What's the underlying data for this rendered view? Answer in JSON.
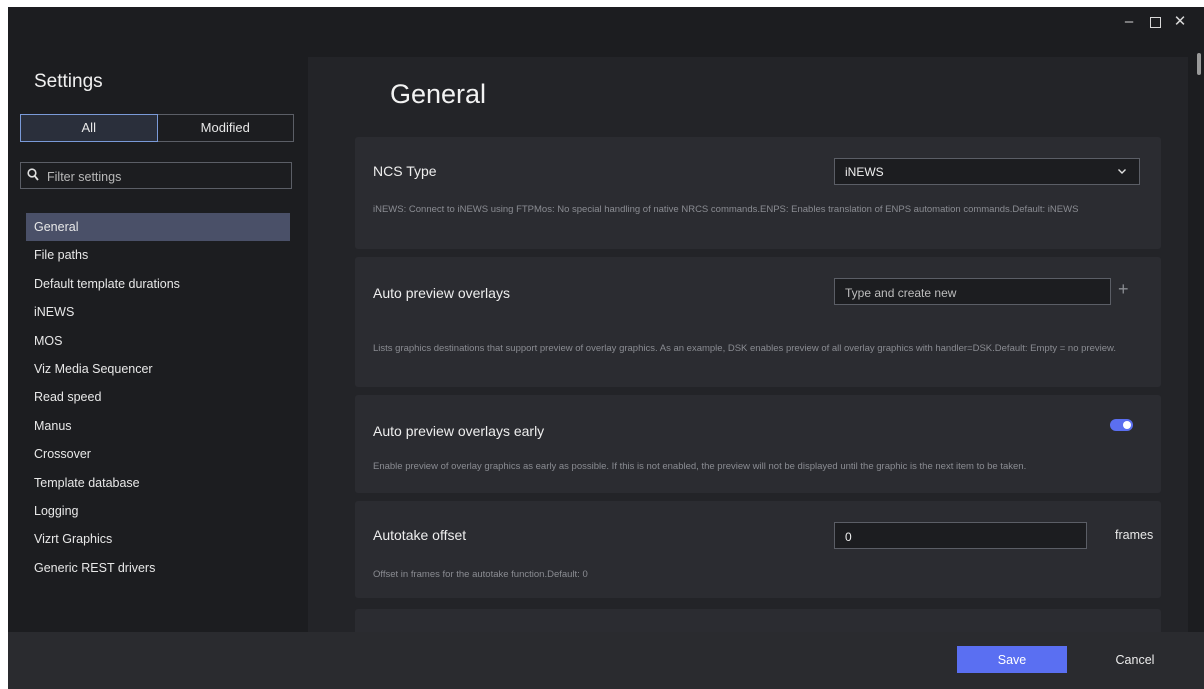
{
  "window": {
    "controls": {
      "minimize": "–",
      "close": "✕"
    }
  },
  "sidebar": {
    "title": "Settings",
    "segments": {
      "all": "All",
      "modified": "Modified"
    },
    "filter_placeholder": "Filter settings",
    "items": [
      {
        "label": "General",
        "active": true
      },
      {
        "label": "File paths"
      },
      {
        "label": "Default template durations"
      },
      {
        "label": "iNEWS"
      },
      {
        "label": "MOS"
      },
      {
        "label": "Viz Media Sequencer"
      },
      {
        "label": "Read speed"
      },
      {
        "label": "Manus"
      },
      {
        "label": "Crossover"
      },
      {
        "label": "Template database"
      },
      {
        "label": "Logging"
      },
      {
        "label": "Vizrt Graphics"
      },
      {
        "label": "Generic REST drivers"
      }
    ]
  },
  "main": {
    "title": "General",
    "settings": [
      {
        "label": "NCS Type",
        "selected": "iNEWS",
        "description": "iNEWS: Connect to iNEWS using FTPMos: No special handling of native NRCS commands.ENPS: Enables translation of ENPS automation commands.Default: iNEWS"
      },
      {
        "label": "Auto preview overlays",
        "placeholder": "Type and create new",
        "add_icon": "+",
        "description": "Lists graphics destinations that support preview of overlay graphics. As an example, DSK enables preview of all overlay graphics with handler=DSK.Default: Empty = no preview."
      },
      {
        "label": "Auto preview overlays early",
        "enabled": true,
        "description": "Enable preview of overlay graphics as early as possible. If this is not enabled, the preview will not be displayed until the graphic is the next item to be taken."
      },
      {
        "label": "Autotake offset",
        "value": "0",
        "unit": "frames",
        "description": "Offset in frames for the autotake function.Default: 0"
      }
    ]
  },
  "footer": {
    "save": "Save",
    "cancel": "Cancel"
  },
  "colors": {
    "accent": "#5a6ff2",
    "background": "#1c1d20",
    "card": "#2b2c31",
    "active_nav": "#4a5068"
  }
}
